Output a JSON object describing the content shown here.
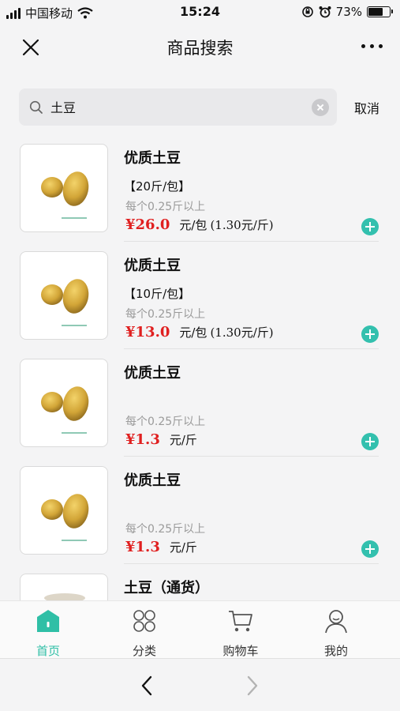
{
  "status_bar": {
    "carrier": "中国移动",
    "time": "15:24",
    "battery": "73%",
    "battery_level": 0.73
  },
  "navbar": {
    "title": "商品搜索"
  },
  "search": {
    "query": "土豆",
    "cancel_label": "取消"
  },
  "products": [
    {
      "name": "优质土豆",
      "spec": "【20斤/包】",
      "note": "每个0.25斤以上",
      "price": "¥26.0",
      "unit": "元/包",
      "unit_extra": "(1.30元/斤)"
    },
    {
      "name": "优质土豆",
      "spec": "【10斤/包】",
      "note": "每个0.25斤以上",
      "price": "¥13.0",
      "unit": "元/包",
      "unit_extra": "(1.30元/斤)"
    },
    {
      "name": "优质土豆",
      "spec": "",
      "note": "每个0.25斤以上",
      "price": "¥1.3",
      "unit": "元/斤",
      "unit_extra": ""
    },
    {
      "name": "优质土豆",
      "spec": "",
      "note": "每个0.25斤以上",
      "price": "¥1.3",
      "unit": "元/斤",
      "unit_extra": ""
    },
    {
      "name": "土豆（通货）",
      "spec": "",
      "note": "",
      "price": "",
      "unit": "",
      "unit_extra": ""
    }
  ],
  "tabbar": {
    "home": "首页",
    "category": "分类",
    "cart": "购物车",
    "mine": "我的"
  },
  "colors": {
    "accent": "#2fbfa6",
    "price": "#e02020",
    "add_button": "#33c0ae"
  },
  "icons": [
    "signal-icon",
    "wifi-icon",
    "rotation-lock-icon",
    "alarm-icon",
    "battery-icon",
    "close-icon",
    "more-icon",
    "search-icon",
    "clear-icon",
    "add-icon",
    "home-icon",
    "category-icon",
    "cart-icon",
    "user-icon",
    "back-arrow-icon",
    "forward-arrow-icon",
    "potato-image"
  ]
}
